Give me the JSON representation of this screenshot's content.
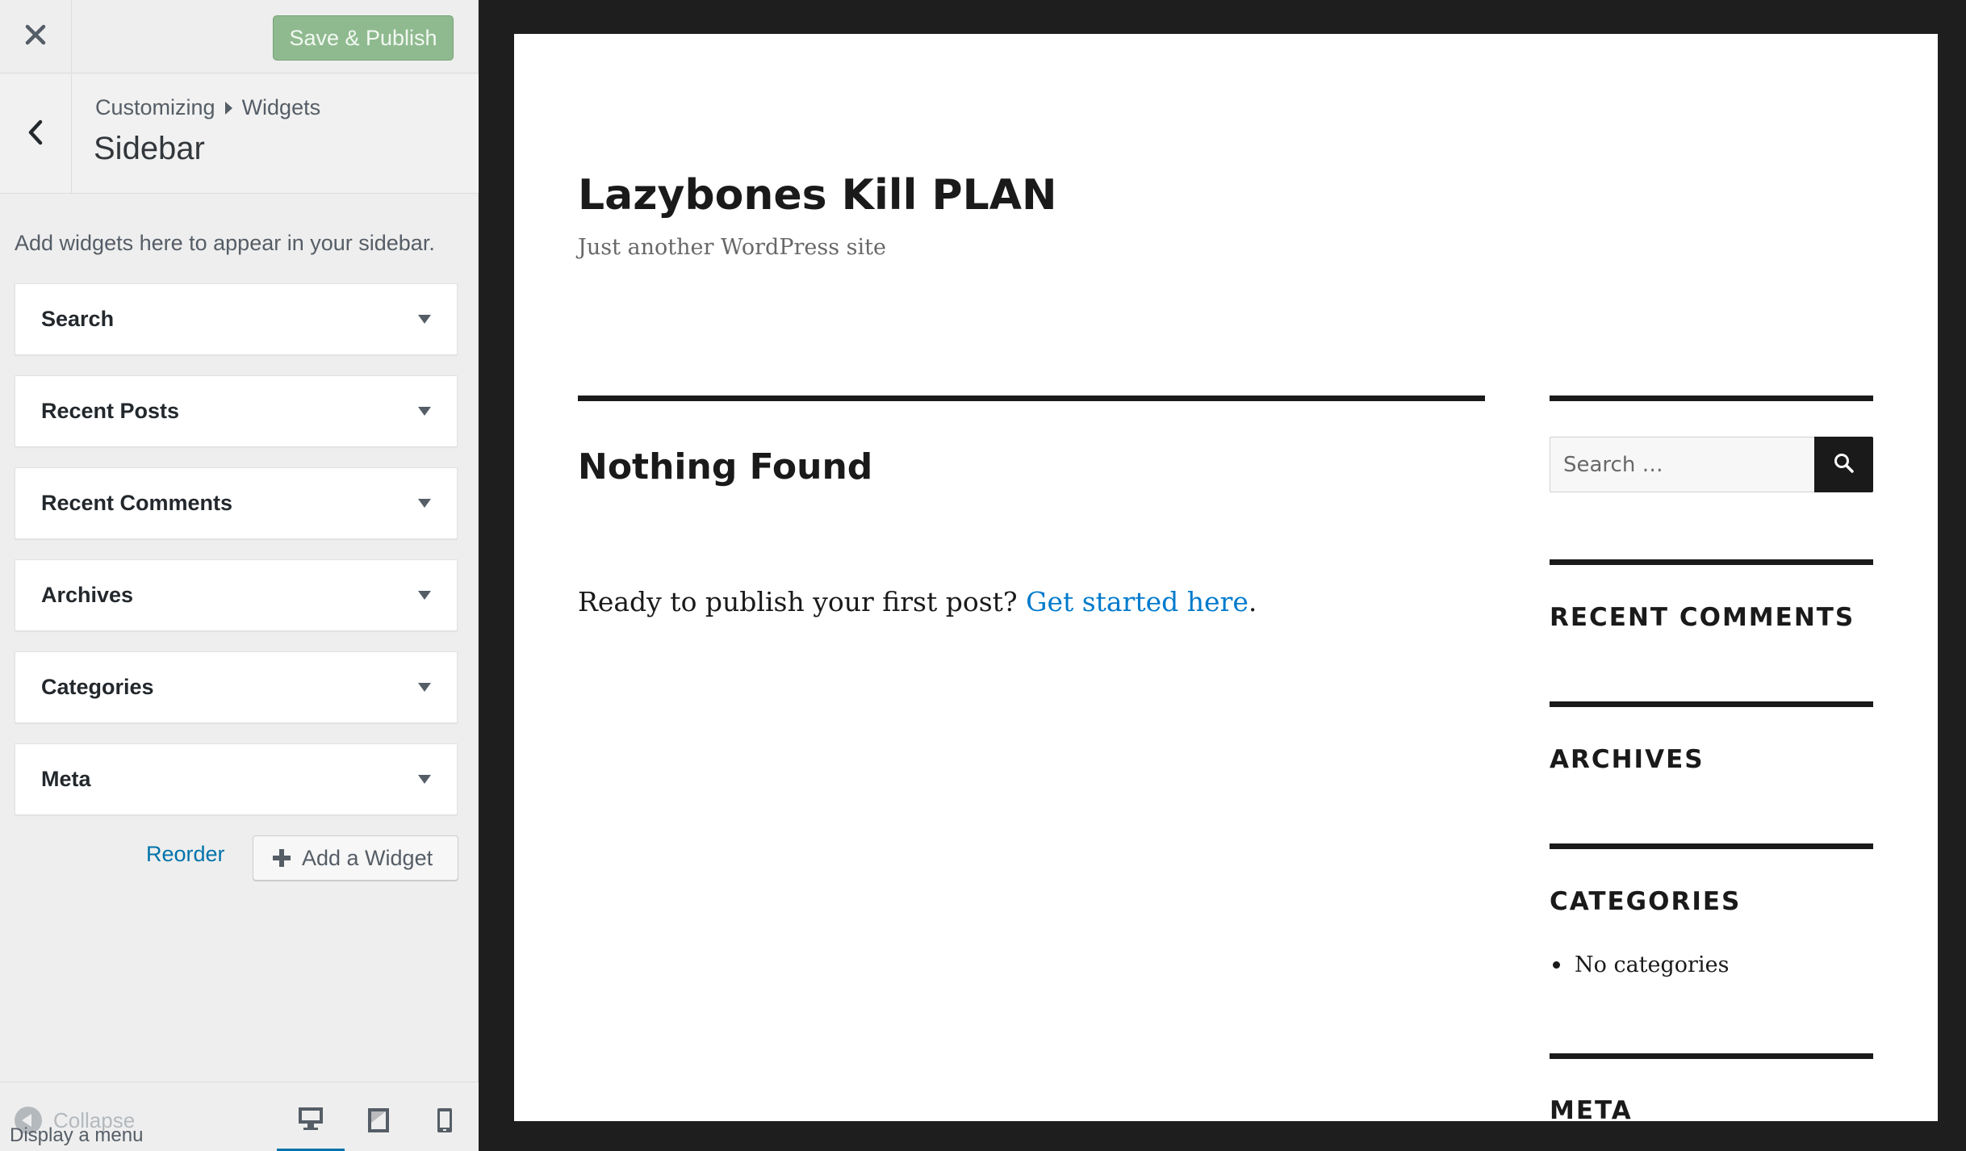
{
  "header": {
    "close_icon": "close-icon",
    "save_label": "Save & Publish",
    "save_color": "#8fba8f"
  },
  "section": {
    "breadcrumb": [
      "Customizing",
      "Widgets"
    ],
    "title": "Sidebar",
    "description": "Add widgets here to appear in your sidebar."
  },
  "widgets": [
    {
      "title": "Search"
    },
    {
      "title": "Recent Posts"
    },
    {
      "title": "Recent Comments"
    },
    {
      "title": "Archives"
    },
    {
      "title": "Categories"
    },
    {
      "title": "Meta"
    }
  ],
  "actions": {
    "reorder_label": "Reorder",
    "add_widget_label": "Add a Widget"
  },
  "footer": {
    "collapse_label": "Collapse",
    "tooltip": "Display a menu",
    "devices": [
      "desktop-icon",
      "tablet-icon",
      "mobile-icon"
    ],
    "active_device": "desktop"
  },
  "preview": {
    "site_title": "Lazybones Kill PLAN",
    "tagline": "Just another WordPress site",
    "heading": "Nothing Found",
    "intro_text": "Ready to publish your first post? ",
    "intro_link": "Get started here",
    "intro_end": ".",
    "link_color": "#007acc",
    "search_placeholder": "Search …",
    "sidebar_widgets": [
      "RECENT COMMENTS",
      "ARCHIVES",
      "CATEGORIES",
      "META"
    ],
    "categories_items": [
      "No categories"
    ]
  }
}
